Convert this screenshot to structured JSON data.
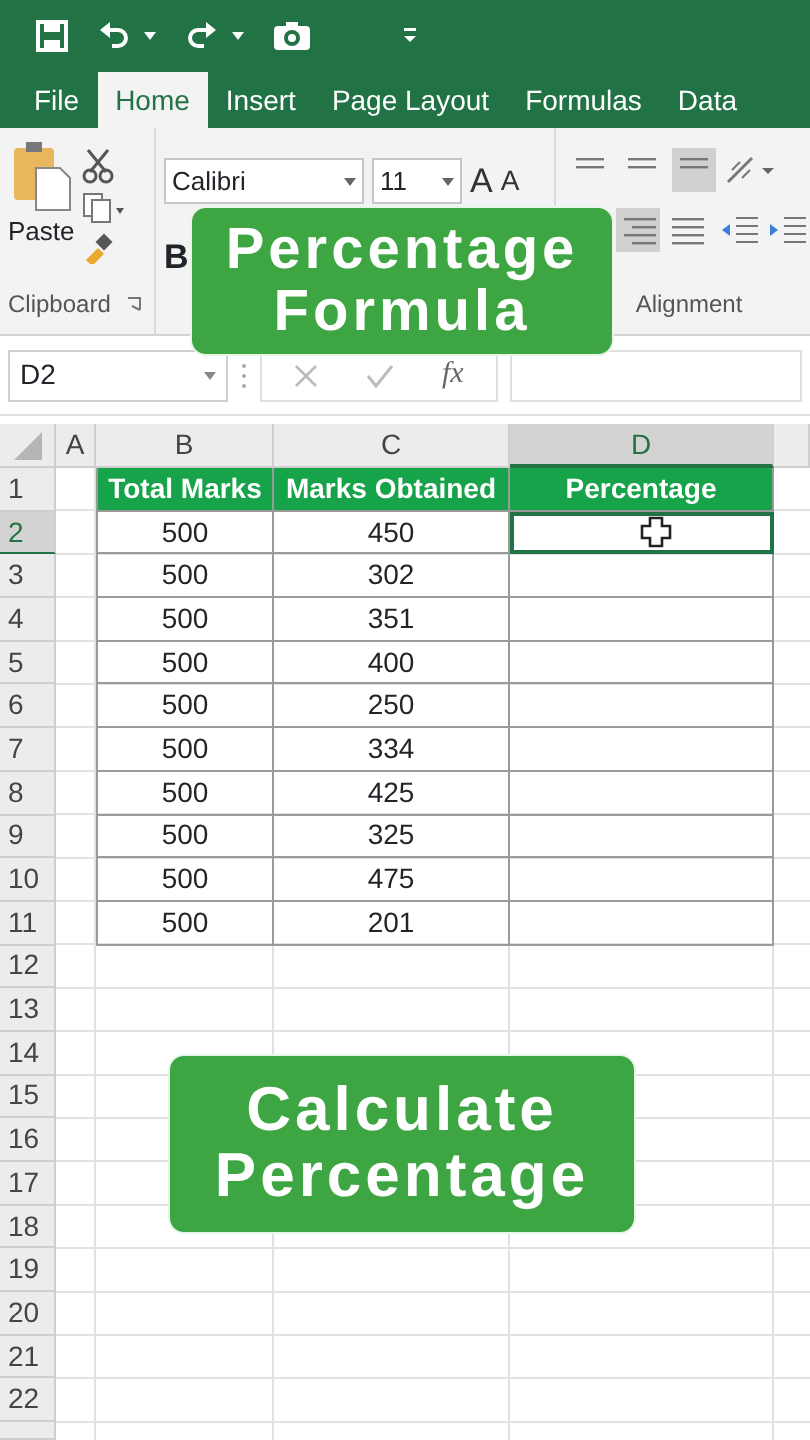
{
  "quick_access": {
    "undo_menu": true,
    "redo_menu": true
  },
  "tabs": [
    {
      "label": "File",
      "selected": false
    },
    {
      "label": "Home",
      "selected": true
    },
    {
      "label": "Insert",
      "selected": false
    },
    {
      "label": "Page Layout",
      "selected": false
    },
    {
      "label": "Formulas",
      "selected": false
    },
    {
      "label": "Data",
      "selected": false
    }
  ],
  "ribbon": {
    "paste_label": "Paste",
    "font_name": "Calibri",
    "font_size": "11",
    "grow_font": "A",
    "shrink_font": "A",
    "bold": "B",
    "groups": [
      "Clipboard",
      "Alignment"
    ]
  },
  "formula_bar": {
    "name_box": "D2",
    "function_label": "fx"
  },
  "sheet": {
    "columns": [
      {
        "label": "A",
        "selected": false
      },
      {
        "label": "B",
        "selected": false
      },
      {
        "label": "C",
        "selected": false
      },
      {
        "label": "D",
        "selected": true
      }
    ],
    "header_row": {
      "number": "1",
      "cells": [
        "Total Marks",
        "Marks Obtained",
        "Percentage"
      ]
    },
    "rows": [
      {
        "number": "2",
        "total_marks": "500",
        "marks_obtained": "450",
        "selected": true
      },
      {
        "number": "3",
        "total_marks": "500",
        "marks_obtained": "302",
        "selected": false
      },
      {
        "number": "4",
        "total_marks": "500",
        "marks_obtained": "351",
        "selected": false
      },
      {
        "number": "5",
        "total_marks": "500",
        "marks_obtained": "400",
        "selected": false
      },
      {
        "number": "6",
        "total_marks": "500",
        "marks_obtained": "250",
        "selected": false
      },
      {
        "number": "7",
        "total_marks": "500",
        "marks_obtained": "334",
        "selected": false
      },
      {
        "number": "8",
        "total_marks": "500",
        "marks_obtained": "425",
        "selected": false
      },
      {
        "number": "9",
        "total_marks": "500",
        "marks_obtained": "325",
        "selected": false
      },
      {
        "number": "10",
        "total_marks": "500",
        "marks_obtained": "475",
        "selected": false
      },
      {
        "number": "11",
        "total_marks": "500",
        "marks_obtained": "201",
        "selected": false
      }
    ],
    "empty_rows": [
      "12",
      "13",
      "14",
      "15",
      "16",
      "17",
      "18",
      "19",
      "20",
      "21",
      "22"
    ]
  },
  "captions": [
    {
      "lines": [
        "Percentage",
        "Formula"
      ]
    },
    {
      "lines": [
        "Calculate",
        "Percentage"
      ]
    }
  ]
}
